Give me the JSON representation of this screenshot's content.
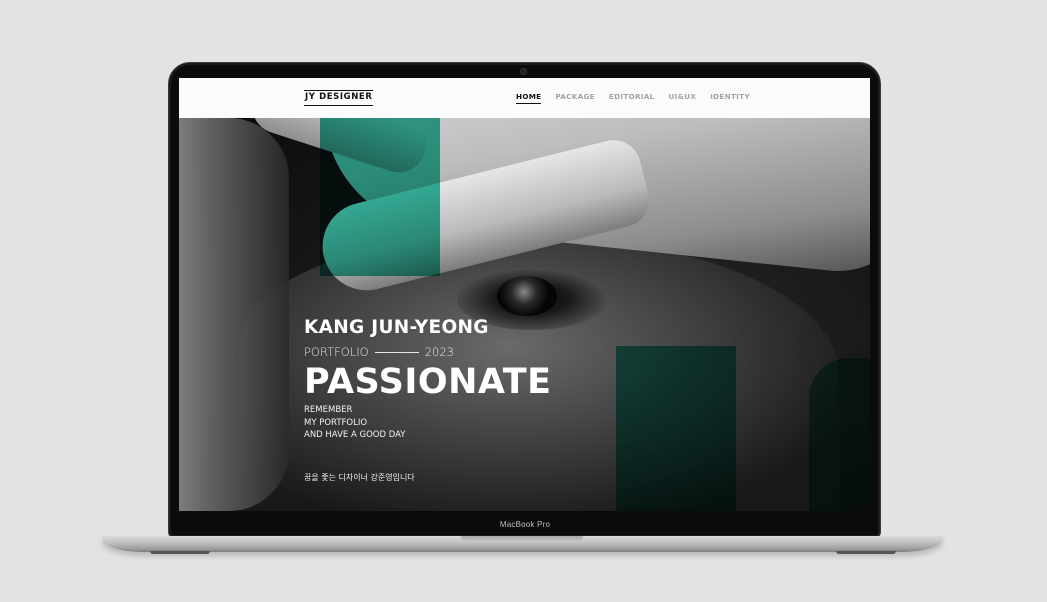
{
  "laptop": {
    "model_label": "MacBook Pro"
  },
  "nav": {
    "logo": "JY DESIGNER",
    "items": [
      {
        "label": "HOME",
        "active": true
      },
      {
        "label": "PACKAGE",
        "active": false
      },
      {
        "label": "EDITORIAL",
        "active": false
      },
      {
        "label": "UI&UX",
        "active": false
      },
      {
        "label": "IDENTITY",
        "active": false
      }
    ]
  },
  "hero": {
    "name": "KANG JUN-YEONG",
    "subtitle_left": "PORTFOLIO",
    "subtitle_right": "2023",
    "headline": "PASSIONATE",
    "tagline": [
      "REMEMBER",
      "MY PORTFOLIO",
      "AND HAVE A GOOD DAY"
    ],
    "korean_line": "꿈을 좇는 디자이너 강준영입니다",
    "accent_color": "#2fb69d"
  }
}
